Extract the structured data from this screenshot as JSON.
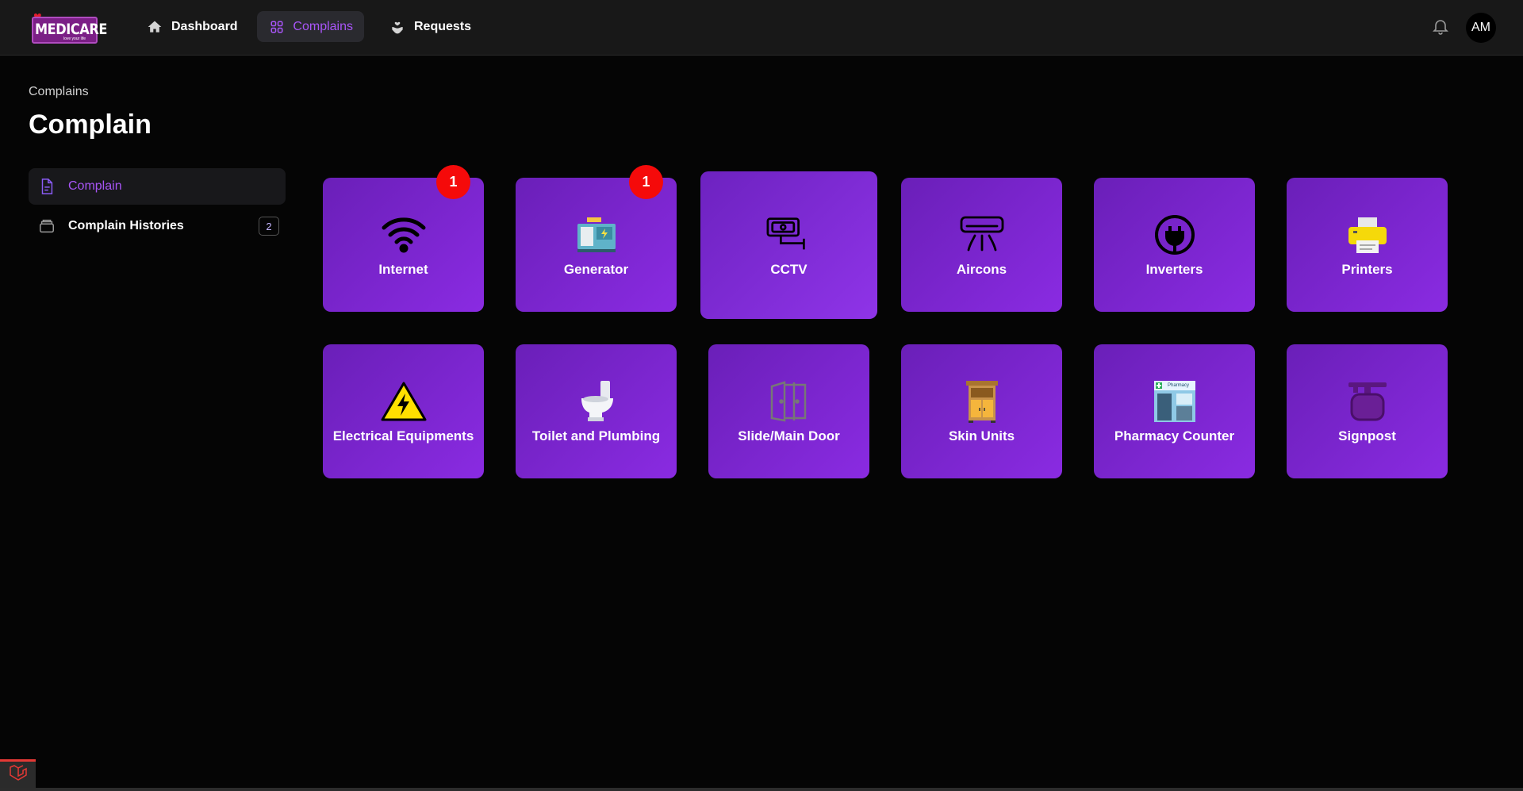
{
  "brand": {
    "name": "MEDICARE",
    "tagline": "love your life"
  },
  "nav": {
    "items": [
      {
        "label": "Dashboard",
        "icon": "home-icon"
      },
      {
        "label": "Complains",
        "icon": "grid-icon",
        "active": true
      },
      {
        "label": "Requests",
        "icon": "heart-hand-icon"
      }
    ]
  },
  "user": {
    "initials": "AM"
  },
  "header": {
    "breadcrumb": "Complains",
    "title": "Complain"
  },
  "sidebar": {
    "items": [
      {
        "label": "Complain",
        "icon": "document-icon",
        "active": true
      },
      {
        "label": "Complain Histories",
        "icon": "archive-icon",
        "count": "2"
      }
    ]
  },
  "tiles": [
    {
      "label": "Internet",
      "icon": "wifi-icon",
      "badge": "1"
    },
    {
      "label": "Generator",
      "icon": "generator-icon",
      "badge": "1"
    },
    {
      "label": "CCTV",
      "icon": "cctv-icon"
    },
    {
      "label": "Aircons",
      "icon": "aircon-icon"
    },
    {
      "label": "Inverters",
      "icon": "plug-icon"
    },
    {
      "label": "Printers",
      "icon": "printer-icon"
    },
    {
      "label": "Electrical Equipments",
      "icon": "high-voltage-icon"
    },
    {
      "label": "Toilet and Plumbing",
      "icon": "toilet-icon"
    },
    {
      "label": "Slide/Main Door",
      "icon": "door-icon"
    },
    {
      "label": "Skin Units",
      "icon": "cabinet-icon"
    },
    {
      "label": "Pharmacy Counter",
      "icon": "pharmacy-icon",
      "sign": "Pharmacy"
    },
    {
      "label": "Signpost",
      "icon": "signpost-icon"
    }
  ],
  "colors": {
    "accent": "#a855f7",
    "tile_start": "#6a1fb8",
    "tile_end": "#8a2be2",
    "badge": "#f50a0a"
  }
}
